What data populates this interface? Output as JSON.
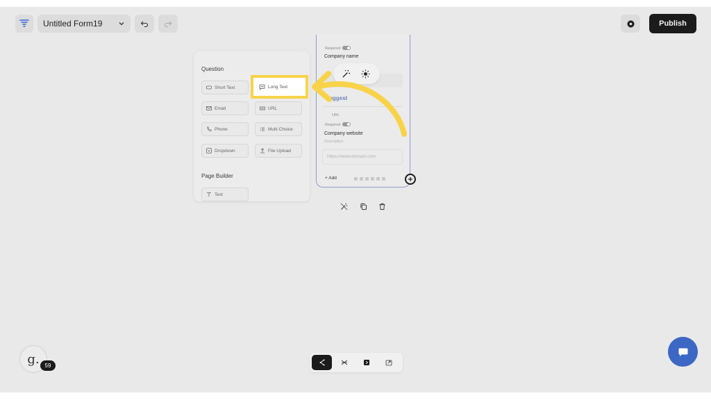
{
  "header": {
    "form_title": "Untitled Form19",
    "publish_label": "Publish"
  },
  "insert_panel": {
    "question_heading": "Question",
    "question_items": [
      "Short Text",
      "Long Text",
      "Email",
      "URL",
      "Phone",
      "Multi Choice",
      "Dropdown",
      "File Upload"
    ],
    "page_builder_heading": "Page Builder",
    "page_builder_items": [
      "Text"
    ]
  },
  "form_card": {
    "required_label": "Required",
    "field1_label": "Company name",
    "suggest_label": "uggest",
    "url_type_label": "URL",
    "field2_label": "Company website",
    "field2_description": "Description",
    "field2_placeholder": "https://www.domain.com",
    "add_label": "+ Add"
  },
  "user": {
    "avatar_letter": "g.",
    "notification_count": "59"
  },
  "colors": {
    "highlight": "#f8d34a",
    "primary_dark": "#1b1b1b",
    "chat_button": "#3c67c4",
    "card_border": "#8b9ec9"
  }
}
